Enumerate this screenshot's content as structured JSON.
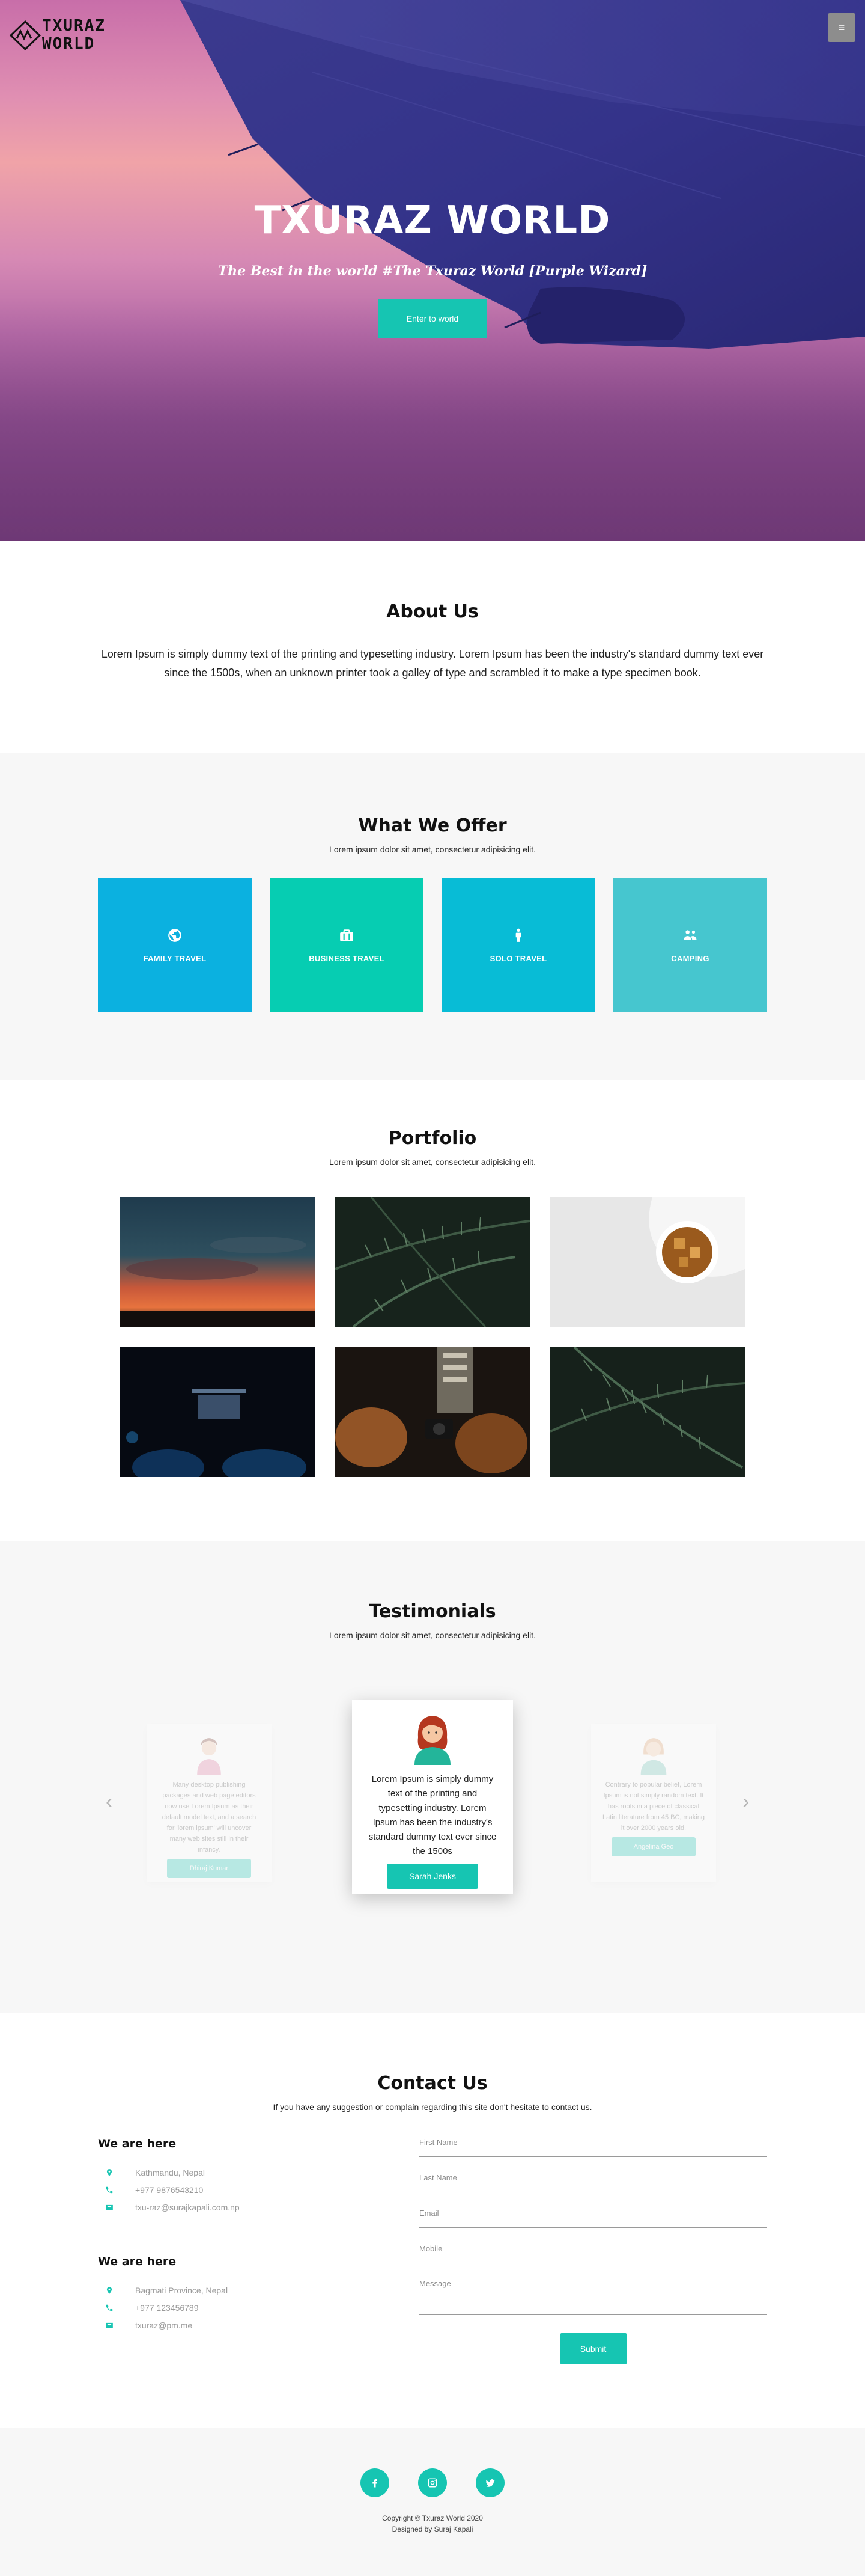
{
  "header": {
    "logo_line1": "TXURAZ",
    "logo_line2": "WORLD",
    "menu_icon": "hamburger-icon"
  },
  "hero": {
    "title": "TXURAZ WORLD",
    "subtitle": "The Best in the world #The Txuraz World [Purple Wizard]",
    "cta_label": "Enter to world"
  },
  "about": {
    "title": "About Us",
    "text": "Lorem Ipsum is simply dummy text of the printing and typesetting industry. Lorem Ipsum has been the industry's standard dummy text ever since the 1500s, when an unknown printer took a galley of type and scrambled it to make a type specimen book."
  },
  "offer": {
    "title": "What We Offer",
    "subtitle": "Lorem ipsum dolor sit amet, consectetur adipisicing elit.",
    "cards": [
      {
        "label": "FAMILY TRAVEL",
        "icon": "globe-icon",
        "color": "#0bb1e0"
      },
      {
        "label": "BUSINESS TRAVEL",
        "icon": "briefcase-icon",
        "color": "#06cdb2"
      },
      {
        "label": "SOLO TRAVEL",
        "icon": "person-icon",
        "color": "#08bcd6"
      },
      {
        "label": "CAMPING",
        "icon": "group-icon",
        "color": "#46c6cf"
      }
    ]
  },
  "portfolio": {
    "title": "Portfolio",
    "subtitle": "Lorem ipsum dolor sit amet, consectetur adipisicing elit."
  },
  "testimonials": {
    "title": "Testimonials",
    "subtitle": "Lorem ipsum dolor sit amet, consectetur adipisicing elit.",
    "items": [
      {
        "text": "Many desktop publishing packages and web page editors now use Lorem Ipsum as their default model text, and a search for 'lorem ipsum' will uncover many web sites still in their infancy.",
        "name": "Dhiraj Kumar"
      },
      {
        "text": "Lorem Ipsum is simply dummy text of the printing and typesetting industry. Lorem Ipsum has been the industry's standard dummy text ever since the 1500s",
        "name": "Sarah Jenks"
      },
      {
        "text": "Contrary to popular belief, Lorem Ipsum is not simply random text. It has roots in a piece of classical Latin literature from 45 BC, making it over 2000 years old.",
        "name": "Angelina Geo"
      }
    ],
    "prev_icon": "chevron-left-icon",
    "next_icon": "chevron-right-icon"
  },
  "contact": {
    "title": "Contact Us",
    "subtitle": "If you have any suggestion or complain regarding this site don't hesitate to contact us.",
    "locations": [
      {
        "title": "We are here",
        "address": "Kathmandu, Nepal",
        "phone": "+977 9876543210",
        "email": "txu-raz@surajkapali.com.np"
      },
      {
        "title": "We are here",
        "address": "Bagmati Province, Nepal",
        "phone": "+977 123456789",
        "email": "txuraz@pm.me"
      }
    ],
    "form": {
      "first_name": "First Name",
      "last_name": "Last Name",
      "email": "Email",
      "mobile": "Mobile",
      "message": "Message",
      "submit": "Submit"
    }
  },
  "footer": {
    "social": [
      {
        "icon": "facebook-icon"
      },
      {
        "icon": "instagram-icon"
      },
      {
        "icon": "twitter-icon"
      }
    ],
    "copyright": "Copyright © Txuraz World 2020",
    "designed_by": "Designed by Suraj Kapali"
  }
}
